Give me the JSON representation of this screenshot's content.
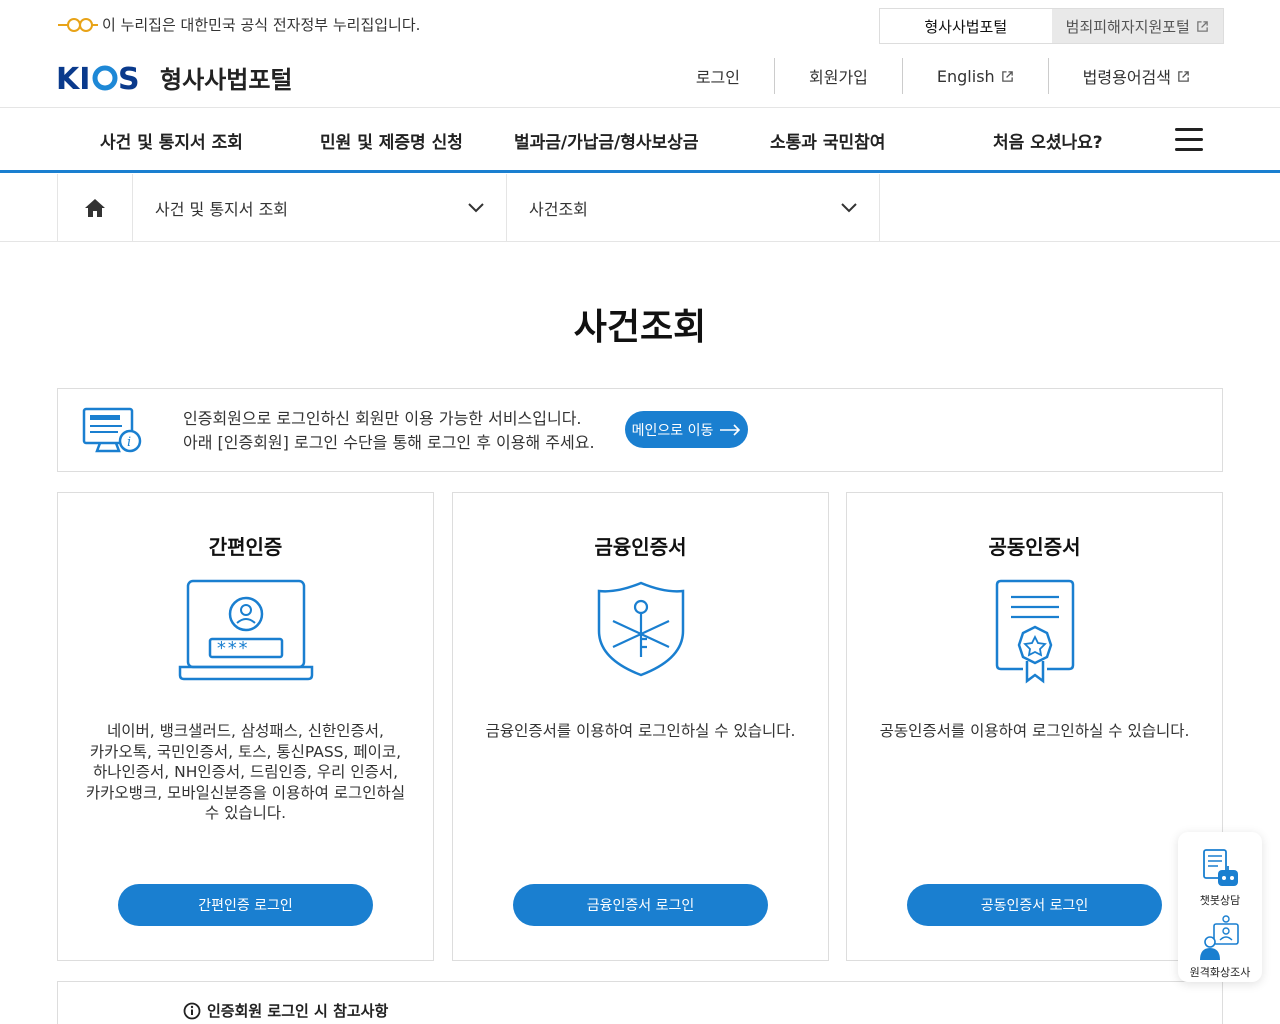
{
  "gov_bar": {
    "text": "이 누리집은 대한민국 공식 전자정부 누리집입니다.",
    "portal_tabs": [
      {
        "label": "형사사법포털"
      },
      {
        "label": "범죄피해자지원포털"
      }
    ]
  },
  "header": {
    "logo_text": "KICS",
    "site_name": "형사사법포털",
    "util_nav": [
      {
        "label": "로그인"
      },
      {
        "label": "회원가입"
      },
      {
        "label": "English"
      },
      {
        "label": "법령용어검색"
      }
    ]
  },
  "gnb": [
    {
      "label": "사건 및 통지서 조회"
    },
    {
      "label": "민원 및 제증명 신청"
    },
    {
      "label": "벌과금/가납금/형사보상금"
    },
    {
      "label": "소통과 국민참여"
    },
    {
      "label": "처음 오셨나요?"
    }
  ],
  "breadcrumb": {
    "level1": "사건 및 통지서 조회",
    "level2": "사건조회"
  },
  "page_title": "사건조회",
  "notice": {
    "line1": "인증회원으로 로그인하신 회원만 이용 가능한 서비스입니다.",
    "line2": "아래 [인증회원] 로그인 수단을 통해 로그인 후 이용해 주세요.",
    "button": "메인으로 이동"
  },
  "cards": [
    {
      "title": "간편인증",
      "desc_lines": [
        "네이버, 뱅크샐러드, 삼성패스, 신한인증서,",
        "카카오톡, 국민인증서, 토스, 통신PASS, 페이코,",
        "하나인증서, NH인증서, 드림인증, 우리 인증서,",
        "카카오뱅크, 모바일신분증을 이용하여 로그인하실",
        "수 있습니다."
      ],
      "button": "간편인증 로그인",
      "icon": "laptop-password-icon"
    },
    {
      "title": "금융인증서",
      "desc_lines": [
        "금융인증서를 이용하여 로그인하실 수 있습니다."
      ],
      "button": "금융인증서 로그인",
      "icon": "shield-key-icon"
    },
    {
      "title": "공동인증서",
      "desc_lines": [
        "공동인증서를 이용하여 로그인하실 수 있습니다."
      ],
      "button": "공동인증서 로그인",
      "icon": "certificate-icon"
    }
  ],
  "reference": {
    "title": "인증회원 로그인 시 참고사항"
  },
  "floating": {
    "chatbot": "챗봇상담",
    "video": "원격화상조사"
  },
  "colors": {
    "accent": "#1a7fd0",
    "logo_navy": "#0a3a8c"
  }
}
